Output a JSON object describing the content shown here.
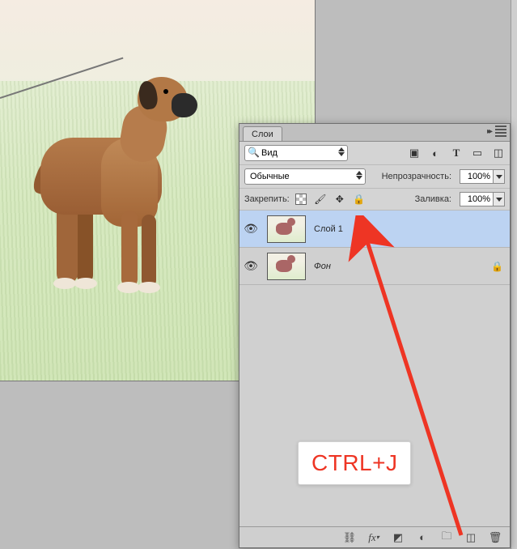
{
  "panel": {
    "title": "Слои",
    "filter": {
      "kind_label": "Вид",
      "icons": [
        "image-filter",
        "adjustment-filter",
        "type-filter",
        "shape-filter",
        "smart-filter"
      ]
    },
    "blend": {
      "mode": "Обычные",
      "opacity_label": "Непрозрачность:",
      "opacity_value": "100%"
    },
    "lock": {
      "label": "Закрепить:",
      "fill_label": "Заливка:",
      "fill_value": "100%"
    },
    "layers": [
      {
        "name": "Слой 1",
        "visible": true,
        "selected": true,
        "locked": false
      },
      {
        "name": "Фон",
        "visible": true,
        "selected": false,
        "locked": true
      }
    ],
    "footer_tools": [
      "link",
      "fx",
      "mask",
      "adjustment",
      "group",
      "new",
      "trash"
    ]
  },
  "annotation": {
    "text": "CTRL+J"
  }
}
